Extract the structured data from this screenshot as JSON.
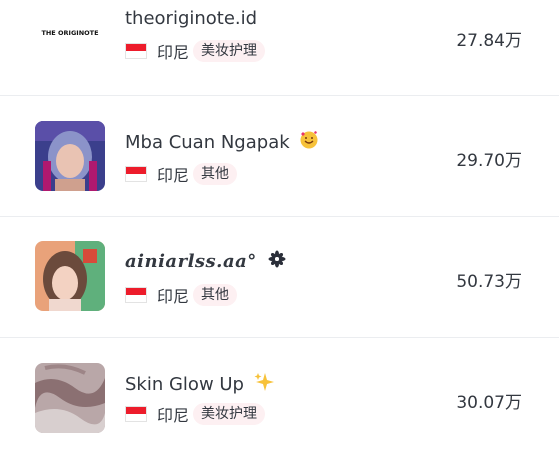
{
  "rows": [
    {
      "name": "theoriginote.id",
      "avatar_text": "THE ORIGINOTE",
      "country": "印尼",
      "category": "美妆护理",
      "followers": "27.84万",
      "emoji": ""
    },
    {
      "name": "Mba Cuan Ngapak",
      "country": "印尼",
      "category": "其他",
      "followers": "29.70万",
      "emoji": "smiling-face-with-hearts-icon"
    },
    {
      "name": "ainiarlss.aa°",
      "country": "印尼",
      "category": "其他",
      "followers": "50.73万",
      "emoji": "flower-icon"
    },
    {
      "name": "Skin Glow Up",
      "country": "印尼",
      "category": "美妆护理",
      "followers": "30.07万",
      "emoji": "sparkles-icon"
    }
  ],
  "colors": {
    "tag_bg": "#fdf0f2",
    "flag_red": "#ed1c2b",
    "divider": "#ebedf0",
    "text": "#333840"
  }
}
